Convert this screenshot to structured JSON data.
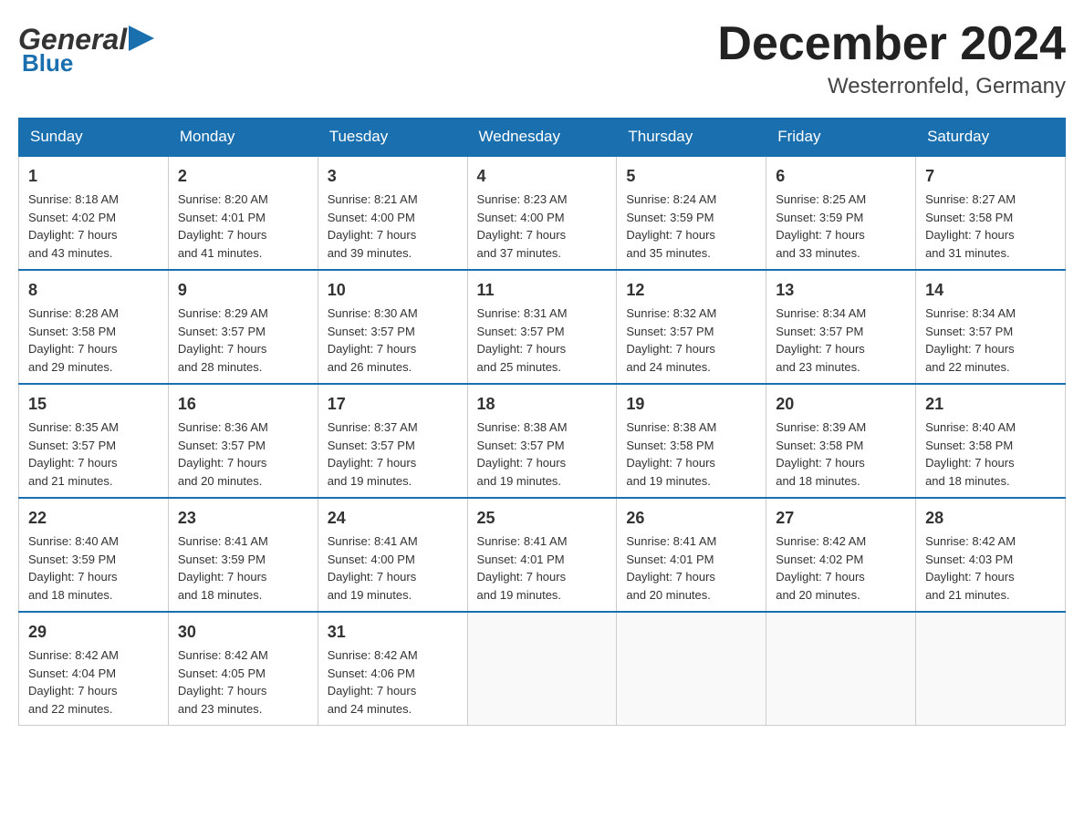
{
  "header": {
    "logo_general": "General",
    "logo_blue": "Blue",
    "month_title": "December 2024",
    "location": "Westerronfeld, Germany"
  },
  "days_of_week": [
    "Sunday",
    "Monday",
    "Tuesday",
    "Wednesday",
    "Thursday",
    "Friday",
    "Saturday"
  ],
  "weeks": [
    [
      {
        "day": "1",
        "sunrise": "8:18 AM",
        "sunset": "4:02 PM",
        "daylight": "7 hours and 43 minutes."
      },
      {
        "day": "2",
        "sunrise": "8:20 AM",
        "sunset": "4:01 PM",
        "daylight": "7 hours and 41 minutes."
      },
      {
        "day": "3",
        "sunrise": "8:21 AM",
        "sunset": "4:00 PM",
        "daylight": "7 hours and 39 minutes."
      },
      {
        "day": "4",
        "sunrise": "8:23 AM",
        "sunset": "4:00 PM",
        "daylight": "7 hours and 37 minutes."
      },
      {
        "day": "5",
        "sunrise": "8:24 AM",
        "sunset": "3:59 PM",
        "daylight": "7 hours and 35 minutes."
      },
      {
        "day": "6",
        "sunrise": "8:25 AM",
        "sunset": "3:59 PM",
        "daylight": "7 hours and 33 minutes."
      },
      {
        "day": "7",
        "sunrise": "8:27 AM",
        "sunset": "3:58 PM",
        "daylight": "7 hours and 31 minutes."
      }
    ],
    [
      {
        "day": "8",
        "sunrise": "8:28 AM",
        "sunset": "3:58 PM",
        "daylight": "7 hours and 29 minutes."
      },
      {
        "day": "9",
        "sunrise": "8:29 AM",
        "sunset": "3:57 PM",
        "daylight": "7 hours and 28 minutes."
      },
      {
        "day": "10",
        "sunrise": "8:30 AM",
        "sunset": "3:57 PM",
        "daylight": "7 hours and 26 minutes."
      },
      {
        "day": "11",
        "sunrise": "8:31 AM",
        "sunset": "3:57 PM",
        "daylight": "7 hours and 25 minutes."
      },
      {
        "day": "12",
        "sunrise": "8:32 AM",
        "sunset": "3:57 PM",
        "daylight": "7 hours and 24 minutes."
      },
      {
        "day": "13",
        "sunrise": "8:34 AM",
        "sunset": "3:57 PM",
        "daylight": "7 hours and 23 minutes."
      },
      {
        "day": "14",
        "sunrise": "8:34 AM",
        "sunset": "3:57 PM",
        "daylight": "7 hours and 22 minutes."
      }
    ],
    [
      {
        "day": "15",
        "sunrise": "8:35 AM",
        "sunset": "3:57 PM",
        "daylight": "7 hours and 21 minutes."
      },
      {
        "day": "16",
        "sunrise": "8:36 AM",
        "sunset": "3:57 PM",
        "daylight": "7 hours and 20 minutes."
      },
      {
        "day": "17",
        "sunrise": "8:37 AM",
        "sunset": "3:57 PM",
        "daylight": "7 hours and 19 minutes."
      },
      {
        "day": "18",
        "sunrise": "8:38 AM",
        "sunset": "3:57 PM",
        "daylight": "7 hours and 19 minutes."
      },
      {
        "day": "19",
        "sunrise": "8:38 AM",
        "sunset": "3:58 PM",
        "daylight": "7 hours and 19 minutes."
      },
      {
        "day": "20",
        "sunrise": "8:39 AM",
        "sunset": "3:58 PM",
        "daylight": "7 hours and 18 minutes."
      },
      {
        "day": "21",
        "sunrise": "8:40 AM",
        "sunset": "3:58 PM",
        "daylight": "7 hours and 18 minutes."
      }
    ],
    [
      {
        "day": "22",
        "sunrise": "8:40 AM",
        "sunset": "3:59 PM",
        "daylight": "7 hours and 18 minutes."
      },
      {
        "day": "23",
        "sunrise": "8:41 AM",
        "sunset": "3:59 PM",
        "daylight": "7 hours and 18 minutes."
      },
      {
        "day": "24",
        "sunrise": "8:41 AM",
        "sunset": "4:00 PM",
        "daylight": "7 hours and 19 minutes."
      },
      {
        "day": "25",
        "sunrise": "8:41 AM",
        "sunset": "4:01 PM",
        "daylight": "7 hours and 19 minutes."
      },
      {
        "day": "26",
        "sunrise": "8:41 AM",
        "sunset": "4:01 PM",
        "daylight": "7 hours and 20 minutes."
      },
      {
        "day": "27",
        "sunrise": "8:42 AM",
        "sunset": "4:02 PM",
        "daylight": "7 hours and 20 minutes."
      },
      {
        "day": "28",
        "sunrise": "8:42 AM",
        "sunset": "4:03 PM",
        "daylight": "7 hours and 21 minutes."
      }
    ],
    [
      {
        "day": "29",
        "sunrise": "8:42 AM",
        "sunset": "4:04 PM",
        "daylight": "7 hours and 22 minutes."
      },
      {
        "day": "30",
        "sunrise": "8:42 AM",
        "sunset": "4:05 PM",
        "daylight": "7 hours and 23 minutes."
      },
      {
        "day": "31",
        "sunrise": "8:42 AM",
        "sunset": "4:06 PM",
        "daylight": "7 hours and 24 minutes."
      },
      null,
      null,
      null,
      null
    ]
  ],
  "labels": {
    "sunrise": "Sunrise:",
    "sunset": "Sunset:",
    "daylight": "Daylight:"
  }
}
